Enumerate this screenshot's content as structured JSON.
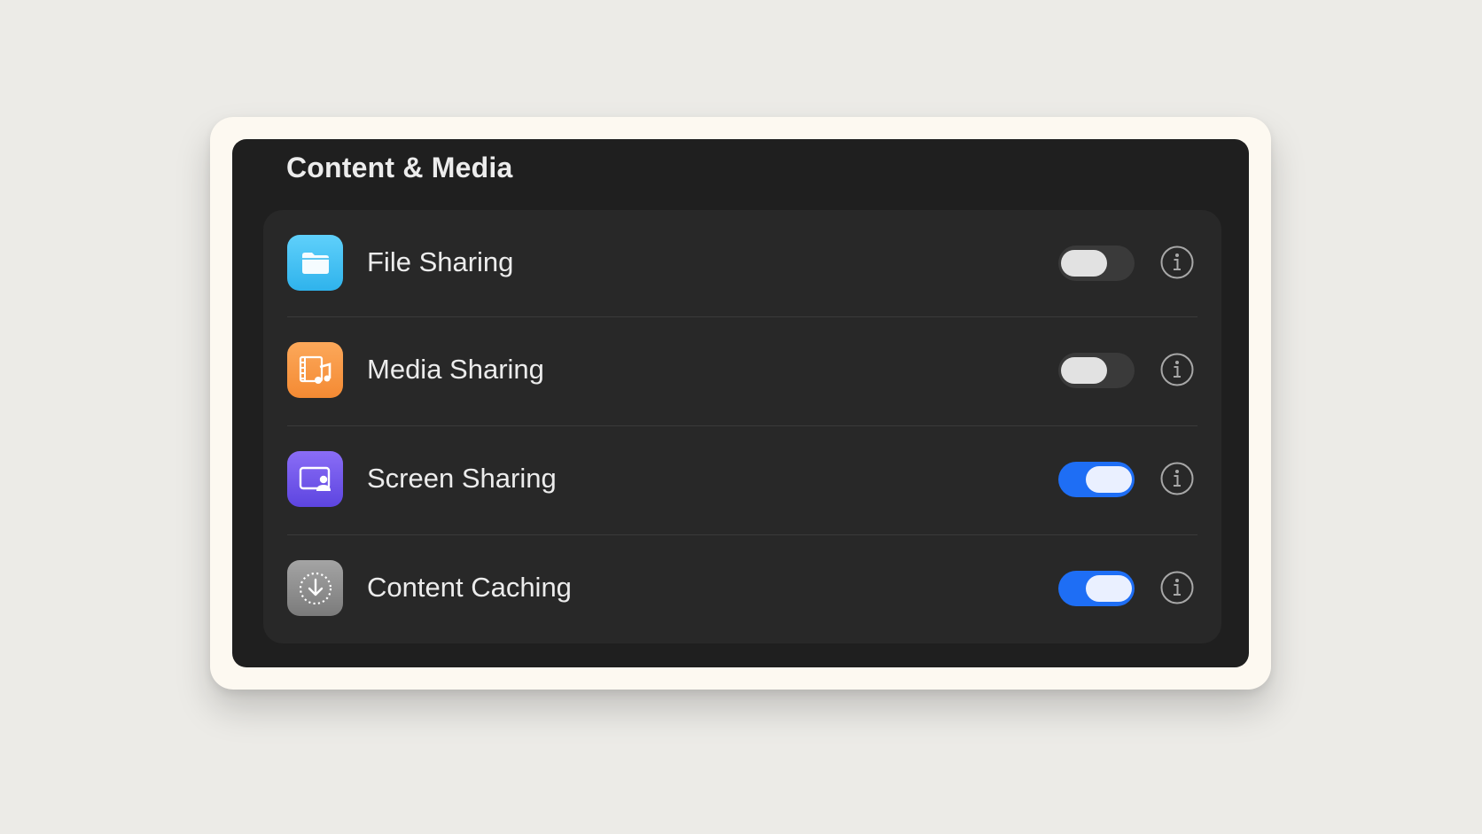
{
  "section": {
    "title": "Content & Media"
  },
  "rows": [
    {
      "label": "File Sharing",
      "icon": "folder-icon",
      "icon_color": "#3fc0f2",
      "enabled": false
    },
    {
      "label": "Media Sharing",
      "icon": "media-film-music-icon",
      "icon_color": "#f7973f",
      "enabled": false
    },
    {
      "label": "Screen Sharing",
      "icon": "screen-share-person-icon",
      "icon_color": "#6f55ea",
      "enabled": true
    },
    {
      "label": "Content Caching",
      "icon": "download-circle-icon",
      "icon_color": "#8e8e8e",
      "enabled": true
    }
  ],
  "colors": {
    "toggle_on": "#1e6ef5",
    "toggle_off": "#3a3a3a",
    "panel_background": "#1f1f1f",
    "group_background": "#282828"
  }
}
